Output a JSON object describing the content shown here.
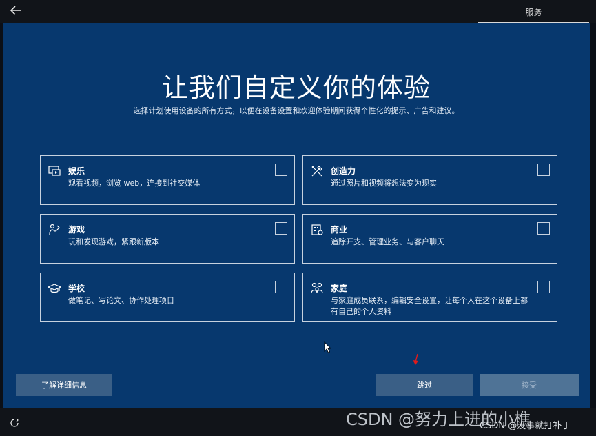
{
  "header": {
    "tab_label": "服务"
  },
  "main": {
    "title": "让我们自定义你的体验",
    "subtitle": "选择计划使用设备的所有方式，以便在设备设置和欢迎体验期间获得个性化的提示、广告和建议。"
  },
  "options": [
    {
      "icon": "entertainment-icon",
      "label": "娱乐",
      "desc": "观看视频，浏览 web，连接到社交媒体",
      "checked": false
    },
    {
      "icon": "creativity-icon",
      "label": "创造力",
      "desc": "通过照片和视频将想法变为现实",
      "checked": false
    },
    {
      "icon": "gaming-icon",
      "label": "游戏",
      "desc": "玩和发现游戏，紧跟新版本",
      "checked": false
    },
    {
      "icon": "business-icon",
      "label": "商业",
      "desc": "追踪开支、管理业务、与客户聊天",
      "checked": false
    },
    {
      "icon": "school-icon",
      "label": "学校",
      "desc": "做笔记、写论文、协作处理项目",
      "checked": false
    },
    {
      "icon": "family-icon",
      "label": "家庭",
      "desc": "与家庭成员联系，编辑安全设置，让每个人在这个设备上都有自己的个人资料",
      "checked": false
    }
  ],
  "buttons": {
    "learn_more": "了解详细信息",
    "skip": "跳过",
    "accept": "接受"
  },
  "watermark": {
    "main": "CSDN @努力上进的小樵",
    "small": "CSDN @没事就打补丁"
  },
  "colors": {
    "panel_bg": "#07386e",
    "bar_bg": "#111419",
    "button_bg": "#3a5f86",
    "accept_disabled_bg": "#4f7396"
  }
}
